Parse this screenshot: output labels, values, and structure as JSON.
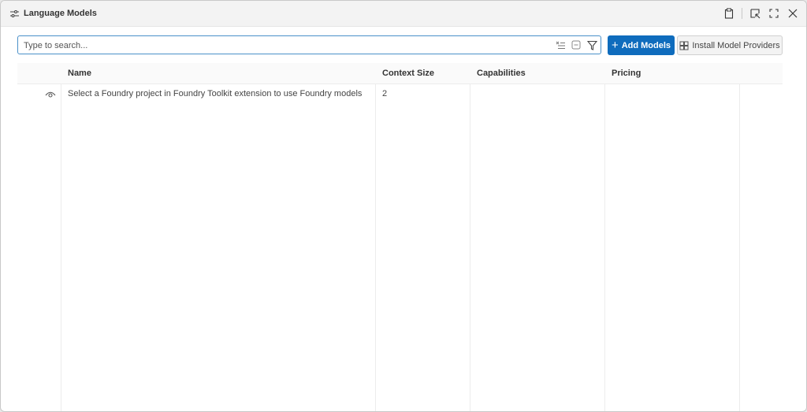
{
  "window": {
    "title": "Language Models",
    "icons": {
      "title": "settings-sliders-icon",
      "paste": "paste-icon",
      "select": "select-region-icon",
      "fullscreen": "fullscreen-icon",
      "close": "close-icon"
    }
  },
  "toolbar": {
    "search_placeholder": "Type to search...",
    "search_value": "",
    "clear_icon": "clear-filter-icon",
    "collapse_icon": "collapse-icon",
    "filter_icon": "filter-icon",
    "add_models_label": "Add Models",
    "install_providers_label": "Install Model Providers",
    "accent_color": "#0f6cbd"
  },
  "table": {
    "columns": [
      "Name",
      "Context Size",
      "Capabilities",
      "Pricing"
    ],
    "rows": [
      {
        "visibility_icon": "eye-icon",
        "name": "Select a Foundry project in Foundry Toolkit extension to use Foundry models",
        "context_size": "2",
        "capabilities": "",
        "pricing": ""
      }
    ]
  }
}
